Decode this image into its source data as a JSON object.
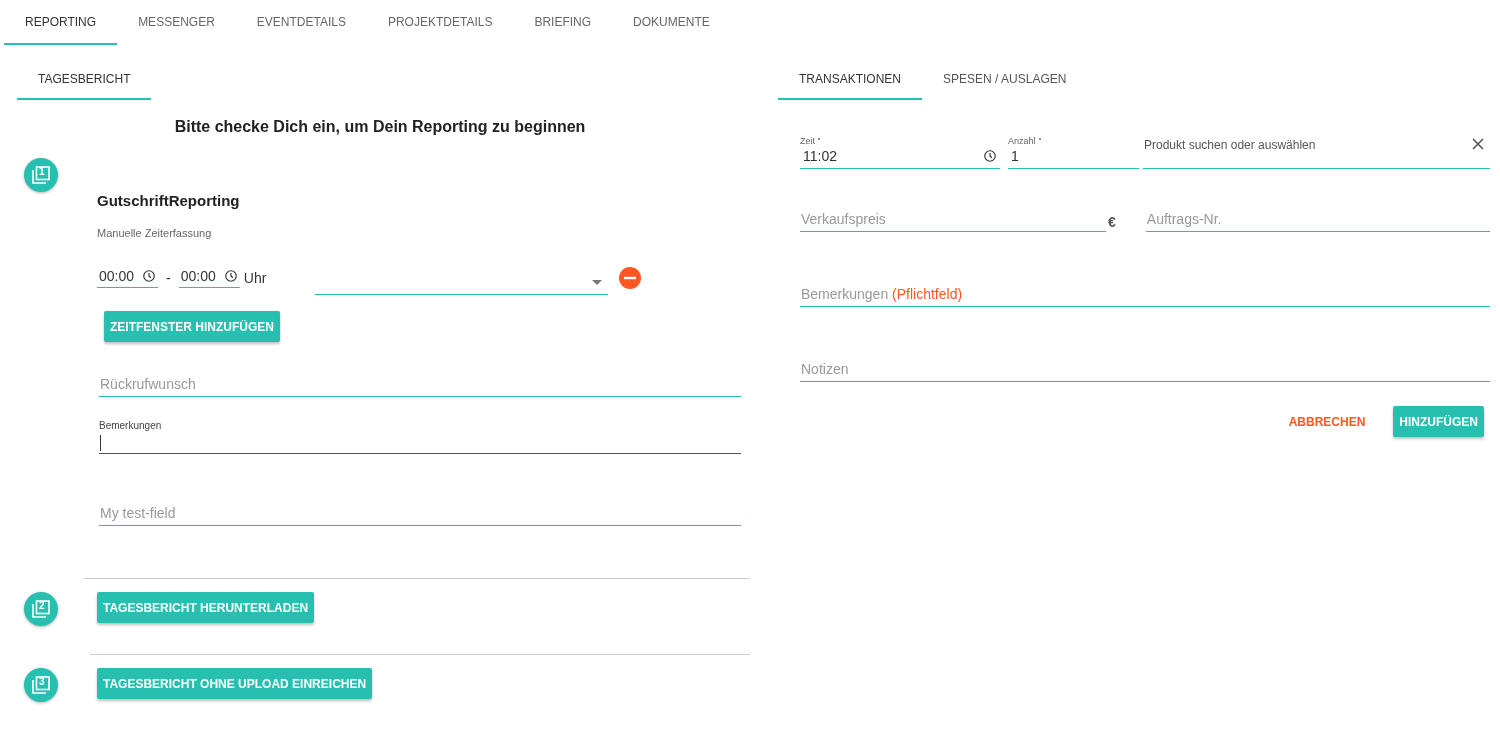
{
  "tabs": [
    {
      "label": "REPORTING",
      "selected": true
    },
    {
      "label": "MESSENGER",
      "selected": false
    },
    {
      "label": "EVENTDETAILS",
      "selected": false
    },
    {
      "label": "PROJEKTDETAILS",
      "selected": false
    },
    {
      "label": "BRIEFING",
      "selected": false
    },
    {
      "label": "DOKUMENTE",
      "selected": false
    }
  ],
  "left": {
    "subtabs": [
      {
        "label": "TAGESBERICHT",
        "selected": true
      }
    ],
    "message": "Bitte checke Dich ein, um Dein Reporting zu beginnen",
    "steps": [
      {
        "number": "1",
        "kind": "form",
        "title": "GutschriftReporting",
        "time_label": "Manuelle Zeiterfassung",
        "time_from": "00:00",
        "separator": "-",
        "time_to": "00:00",
        "unit": "Uhr",
        "button": "ZEITFENSTER HINZUFÜGEN",
        "fields": [
          {
            "placeholder": "Rückrufwunsch",
            "focused": false
          },
          {
            "label": "Bemerkungen",
            "focused": true
          },
          {
            "placeholder": "My test-field",
            "focused": false
          }
        ]
      },
      {
        "number": "2",
        "kind": "button",
        "button": "TAGESBERICHT HERUNTERLADEN"
      },
      {
        "number": "3",
        "kind": "button",
        "button": "TAGESBERICHT OHNE UPLOAD EINREICHEN"
      }
    ]
  },
  "right": {
    "tabs": [
      {
        "label": "TRANSAKTIONEN",
        "selected": true
      },
      {
        "label": "SPESEN / AUSLAGEN",
        "selected": false
      }
    ],
    "time": {
      "label": "Zeit",
      "required": true,
      "value": "11:02"
    },
    "quantity": {
      "label": "Anzahl",
      "required": true,
      "value": "1"
    },
    "product": {
      "placeholder": "Produkt suchen oder auswählen"
    },
    "price": {
      "placeholder": "Verkaufspreis",
      "currency": "€"
    },
    "order": {
      "placeholder": "Auftrags-Nr."
    },
    "remarks": {
      "placeholder": "Bemerkungen",
      "required_note": "(Pflichtfeld)"
    },
    "notes": {
      "placeholder": "Notizen"
    },
    "cancel": "ABBRECHEN",
    "submit": "HINZUFÜGEN"
  }
}
